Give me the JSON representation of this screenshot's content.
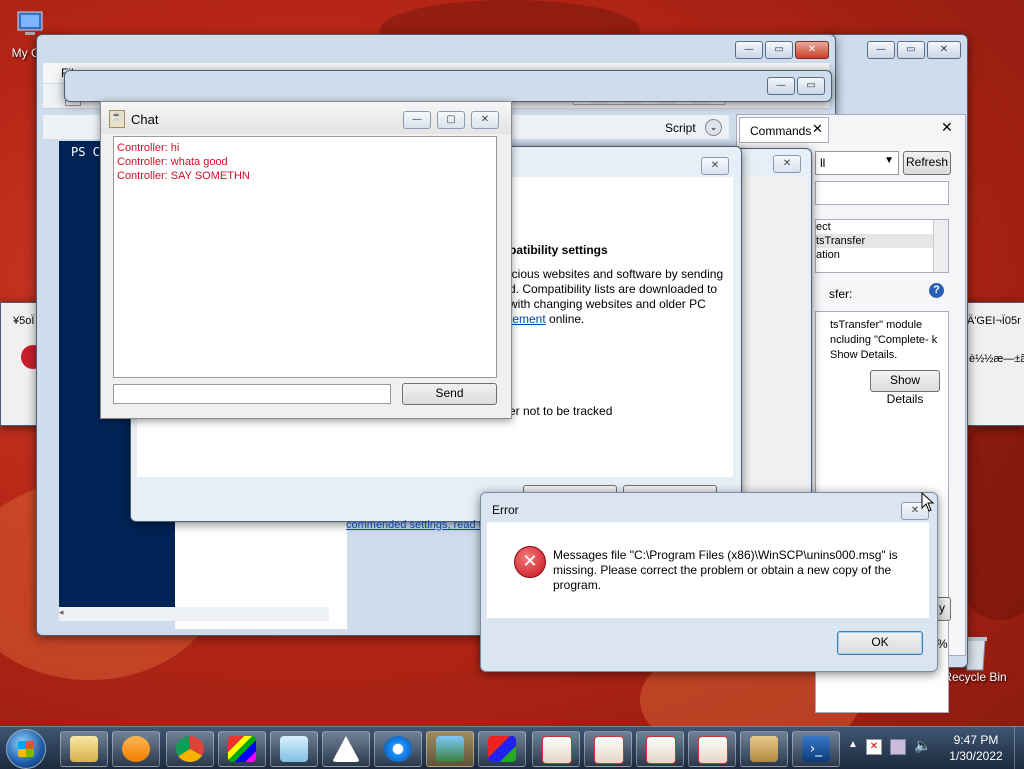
{
  "desktop": {
    "icons": [
      {
        "label": "My Co"
      },
      {
        "label": "Recycle Bin"
      }
    ],
    "bg_colors": {
      "accent": "#c1301c"
    }
  },
  "ise": {
    "menu_file": "File",
    "script_label": "Script",
    "commands_tab": "Commands",
    "refresh": "Refresh",
    "dropdown_value": "ll",
    "console_text": "PS C",
    "commands_list": [
      "ect",
      "tsTransfer",
      "ation"
    ],
    "params_label": "sfer:",
    "desc": "tsTransfer\" module ncluding \"Complete- k Show Details.",
    "show_details": "Show Details",
    "insert_btn": "y",
    "zoom": "%"
  },
  "ie_dialog": {
    "heading": "patibility settings",
    "body_lines": [
      "icious websites and software by sending",
      "d. Compatibility lists are downloaded to",
      "with changing websites and older PC"
    ],
    "link": "tement",
    "link_suffix": " online.",
    "track_text": "er not to be tracked",
    "bottom_link": "commended settings, read th"
  },
  "chat": {
    "title": "Chat",
    "messages": [
      "Controller: hi",
      "Controller: whata good",
      "Controller: SAY SOMETHN"
    ],
    "input_value": "",
    "send": "Send"
  },
  "side_dialog_left": {
    "title": "¥5oÏ é"
  },
  "side_dialog_right": {
    "title": "Ä'GEI¬Ï05r",
    "text": "è½½æ—±ã"
  },
  "error": {
    "title": "Error",
    "message": "Messages file \"C:\\Program Files (x86)\\WinSCP\\unins000.msg\" is missing. Please correct the problem or obtain a new copy of the program.",
    "ok": "OK"
  },
  "taskbar": {
    "clock_time": "9:47 PM",
    "clock_date": "1/30/2022",
    "apps": [
      "explorer",
      "media-player",
      "chrome",
      "matlab",
      "notepad",
      "java-duke",
      "internet-explorer",
      "photo-viewer",
      "shapes-app",
      "java",
      "java",
      "java",
      "java",
      "installer",
      "powershell"
    ]
  }
}
